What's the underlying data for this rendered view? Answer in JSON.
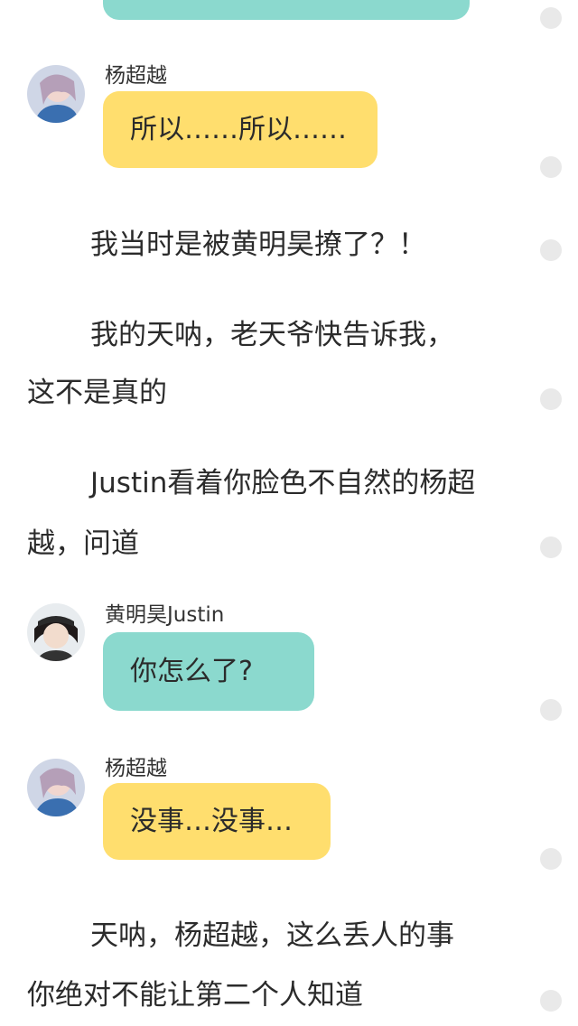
{
  "colors": {
    "teal_bubble": "#8BD9CE",
    "yellow_bubble": "#FFDE6E",
    "scroll_dot": "#E9E9E9",
    "text": "#2B2B2B"
  },
  "messages": [
    {
      "speaker": "杨超越",
      "text": "所以……所以……",
      "avatar": "yang-chaoyue-avatar"
    },
    {
      "speaker": "黄明昊Justin",
      "text": "你怎么了?",
      "avatar": "justin-avatar"
    },
    {
      "speaker": "杨超越",
      "text": "没事…没事…",
      "avatar": "yang-chaoyue-avatar"
    }
  ],
  "narration": {
    "p1_l1": "我当时是被黄明昊撩了？！",
    "p2_l1": "我的天呐，老天爷快告诉我，",
    "p2_l2": "这不是真的",
    "p3_l1": "Justin看着你脸色不自然的杨超",
    "p3_l2": "越，问道",
    "p4_l1": "天呐，杨超越，这么丢人的事",
    "p4_l2": "你绝对不能让第二个人知道"
  }
}
